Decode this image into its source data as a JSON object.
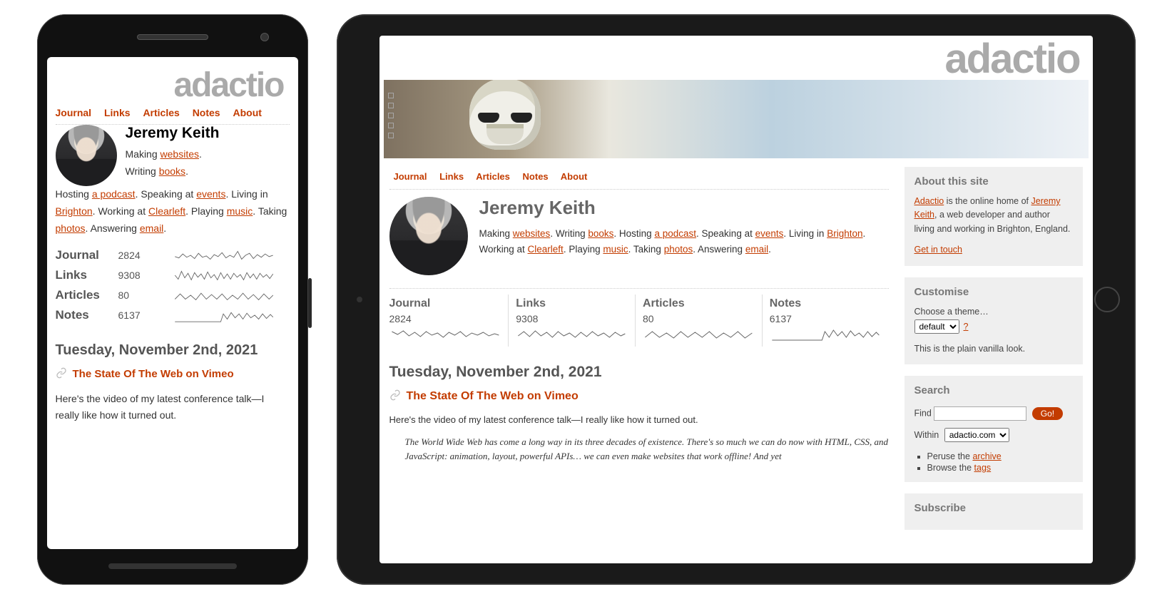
{
  "site": {
    "logo": "adactio"
  },
  "nav": {
    "journal": "Journal",
    "links": "Links",
    "articles": "Articles",
    "notes": "Notes",
    "about": "About"
  },
  "bio": {
    "name": "Jeremy Keith",
    "segments": {
      "making": "Making ",
      "websites": "websites",
      "dot": ".",
      "writing": " Writing ",
      "books": "books",
      "hosting": " Hosting ",
      "podcast": "a podcast",
      "speaking": " Speaking at ",
      "events": "events",
      "living": " Living in ",
      "brighton": "Brighton",
      "working": " Working at ",
      "clearleft": "Clearleft",
      "playing": " Playing ",
      "music": "music",
      "taking": " Taking ",
      "photos": "photos",
      "answering": " Answering ",
      "email": "email"
    }
  },
  "stats": {
    "journal": {
      "label": "Journal",
      "count": "2824"
    },
    "links": {
      "label": "Links",
      "count": "9308"
    },
    "articles": {
      "label": "Articles",
      "count": "80"
    },
    "notes": {
      "label": "Notes",
      "count": "6137"
    }
  },
  "post": {
    "date": "Tuesday, November 2nd, 2021",
    "title": "The State Of The Web on Vimeo",
    "excerpt": "Here's the video of my latest conference talk—I really like how it turned out.",
    "quote": "The World Wide Web has come a long way in its three decades of existence. There's so much we can do now with HTML, CSS, and JavaScript: animation, layout, powerful APIs… we can even make websites that work offline! And yet"
  },
  "about_panel": {
    "title": "About this site",
    "adactio": "Adactio",
    "is_home": " is the online home of ",
    "jeremy": "Jeremy Keith",
    "rest": ", a web developer and author living and working in Brighton, England.",
    "get_in_touch": "Get in touch"
  },
  "customise_panel": {
    "title": "Customise",
    "choose": "Choose a theme…",
    "selected": "default",
    "qmark": "?",
    "desc": "This is the plain vanilla look."
  },
  "search_panel": {
    "title": "Search",
    "find": "Find",
    "go": "Go!",
    "within": "Within",
    "scope": "adactio.com",
    "peruse": "Peruse the ",
    "archive": "archive",
    "browse": "Browse the ",
    "tags": "tags"
  },
  "subscribe_panel": {
    "title": "Subscribe"
  }
}
